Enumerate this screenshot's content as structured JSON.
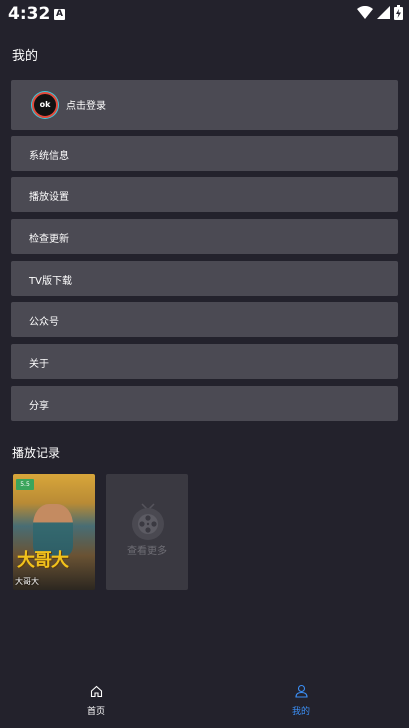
{
  "status_bar": {
    "time": "4:32",
    "notification_icon": "A"
  },
  "page": {
    "title": "我的"
  },
  "login": {
    "avatar_text": "ok",
    "label": "点击登录"
  },
  "menu": [
    {
      "id": "system-info",
      "label": "系统信息"
    },
    {
      "id": "playback-settings",
      "label": "播放设置"
    },
    {
      "id": "check-update",
      "label": "检查更新"
    },
    {
      "id": "tv-download",
      "label": "TV版下载"
    },
    {
      "id": "official-account",
      "label": "公众号"
    },
    {
      "id": "about",
      "label": "关于"
    },
    {
      "id": "share",
      "label": "分享"
    }
  ],
  "history": {
    "title": "播放记录",
    "items": [
      {
        "name": "大哥大",
        "badge": "5.5",
        "poster_title": "大哥大"
      }
    ],
    "more_label": "查看更多"
  },
  "bottom_nav": [
    {
      "label": "首页",
      "icon": "home-icon",
      "active": false
    },
    {
      "label": "我的",
      "icon": "user-icon",
      "active": true
    }
  ],
  "colors": {
    "background": "#23222c",
    "card": "#4b4a53",
    "accent": "#3b8ff5"
  }
}
